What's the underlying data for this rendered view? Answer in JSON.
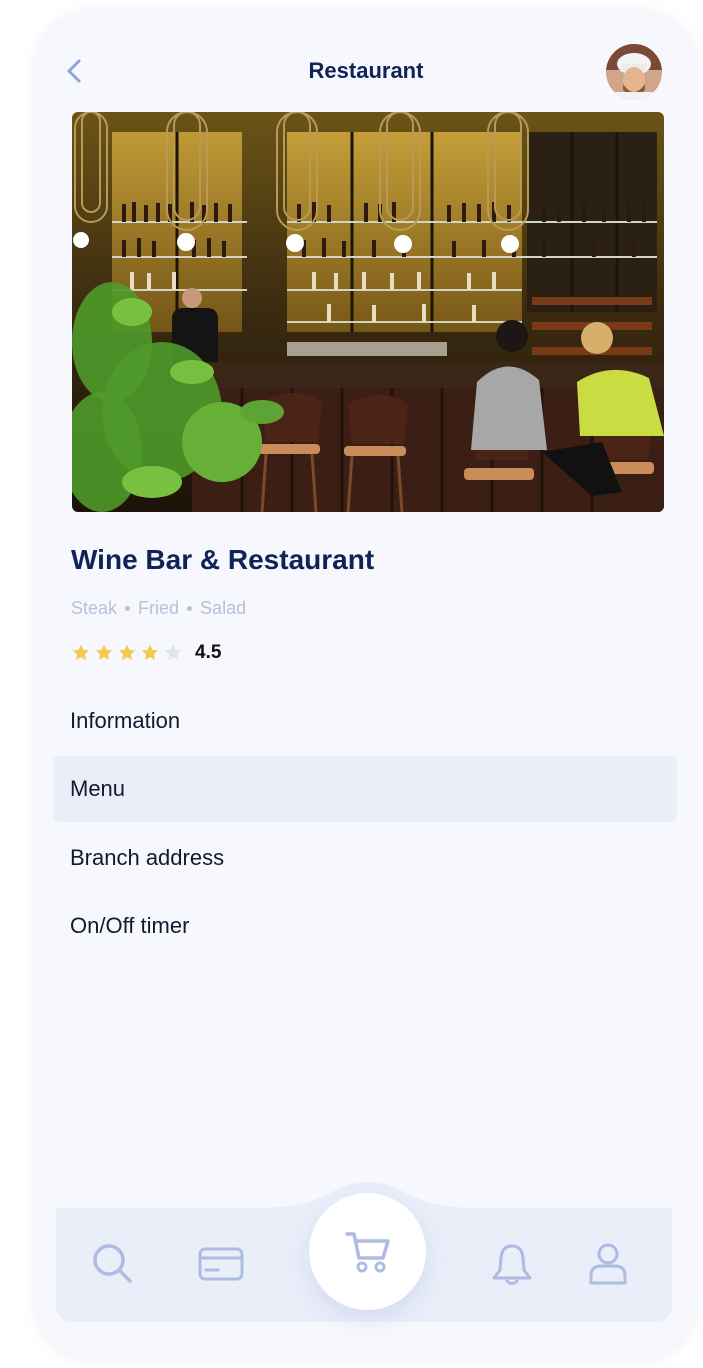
{
  "header": {
    "title": "Restaurant"
  },
  "restaurant": {
    "name": "Wine Bar & Restaurant",
    "tags": [
      "Steak",
      "Fried",
      "Salad"
    ],
    "rating_value": "4.5",
    "rating": 4.5,
    "stars_total": 5
  },
  "menu": {
    "items": [
      {
        "label": "Information"
      },
      {
        "label": "Menu"
      },
      {
        "label": "Branch address"
      },
      {
        "label": "On/Off timer"
      }
    ],
    "selected": "Menu"
  },
  "icons": {
    "back": "chevron-left-icon",
    "search": "search-icon",
    "card": "credit-card-icon",
    "cart": "cart-icon",
    "bell": "bell-icon",
    "user": "user-icon"
  },
  "colors": {
    "title": "#0f2357",
    "accent_icon": "#aebbe3",
    "star": "#f5c94c",
    "star_empty": "#dfe3ee",
    "selected_bg": "#e9eef9"
  }
}
